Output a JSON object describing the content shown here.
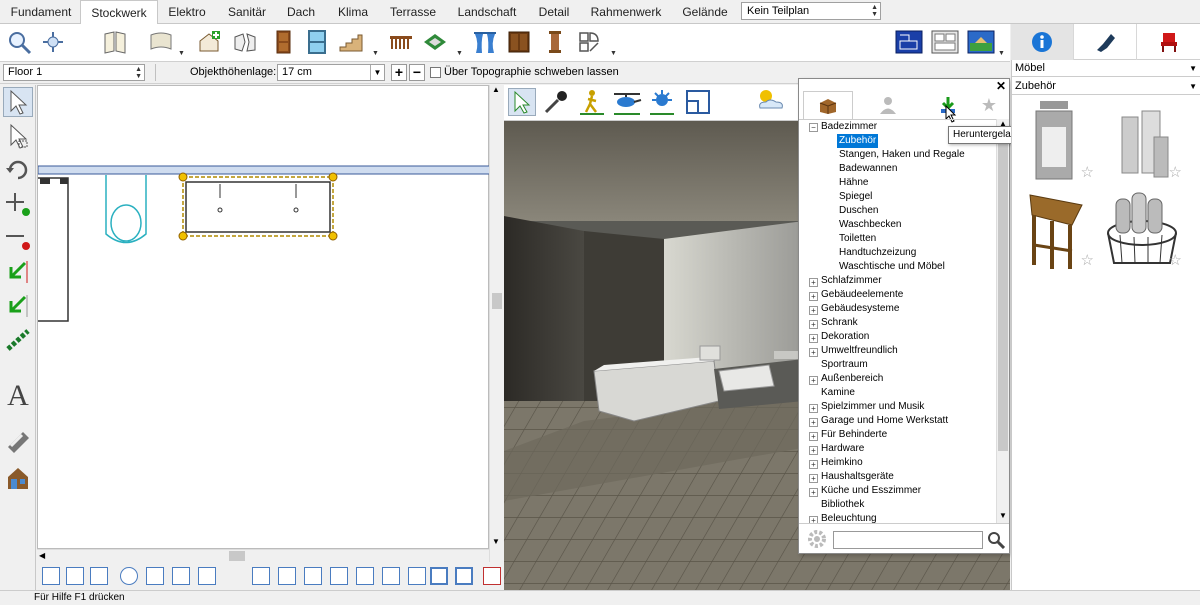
{
  "tabs": [
    "Fundament",
    "Stockwerk",
    "Elektro",
    "Sanitär",
    "Dach",
    "Klima",
    "Terrasse",
    "Landschaft",
    "Detail",
    "Rahmenwerk",
    "Gelände"
  ],
  "active_tab": "Stockwerk",
  "plan_select": "Kein Teilplan",
  "floor_select": "Floor 1",
  "height_label": "Objekthöhenlage:",
  "height_value": "17 cm",
  "topography_checkbox": "Über Topographie schweben lassen",
  "library": {
    "tooltip": "Heruntergeladene Bibliotheksobjekte anzeigen",
    "tree": [
      {
        "label": "Badezimmer",
        "expanded": true,
        "children": [
          "Zubehör",
          "Stangen, Haken und Regale",
          "Badewannen",
          "Hähne",
          "Spiegel",
          "Duschen",
          "Waschbecken",
          "Toiletten",
          "Handtuchzeizung",
          "Waschtische und Möbel"
        ]
      },
      {
        "label": "Schlafzimmer"
      },
      {
        "label": "Gebäudeelemente"
      },
      {
        "label": "Gebäudesysteme"
      },
      {
        "label": "Schrank"
      },
      {
        "label": "Dekoration"
      },
      {
        "label": "Umweltfreundlich"
      },
      {
        "label": "Sportraum",
        "leaf": true
      },
      {
        "label": "Außenbereich"
      },
      {
        "label": "Kamine",
        "leaf": true
      },
      {
        "label": "Spielzimmer und Musik"
      },
      {
        "label": "Garage und Home Werkstatt"
      },
      {
        "label": "Für Behinderte"
      },
      {
        "label": "Hardware"
      },
      {
        "label": "Heimkino"
      },
      {
        "label": "Haushaltsgeräte"
      },
      {
        "label": "Küche und Esszimmer"
      },
      {
        "label": "Bibliothek",
        "leaf": true
      },
      {
        "label": "Beleuchtung"
      }
    ],
    "selected": "Zubehör"
  },
  "catalog": {
    "category": "Möbel",
    "subcategory": "Zubehör"
  },
  "status": "Für Hilfe F1 drücken",
  "colors": {
    "accent": "#0078d7",
    "selection": "#f0c000",
    "plan_line": "#2ab0c0"
  }
}
